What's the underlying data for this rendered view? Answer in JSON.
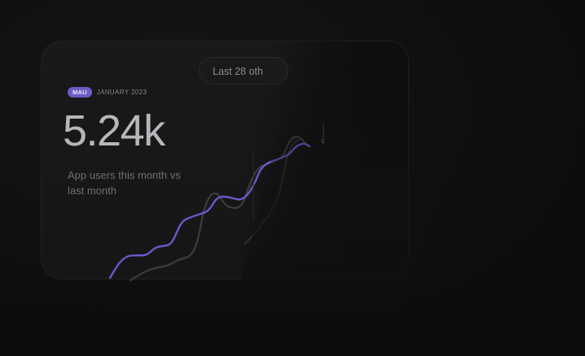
{
  "card": {
    "period_label": "Last 28 oth",
    "badge": "MAU",
    "date": "JANUARY 2023",
    "metric": "5.24k",
    "caption": "App users this month vs last month",
    "tooltip_fragment": "c"
  },
  "colors": {
    "accent": "#6e5bc4",
    "current_series": "#6b58c9",
    "previous_series": "#4a4a4e",
    "background": "#0f0f10"
  }
}
